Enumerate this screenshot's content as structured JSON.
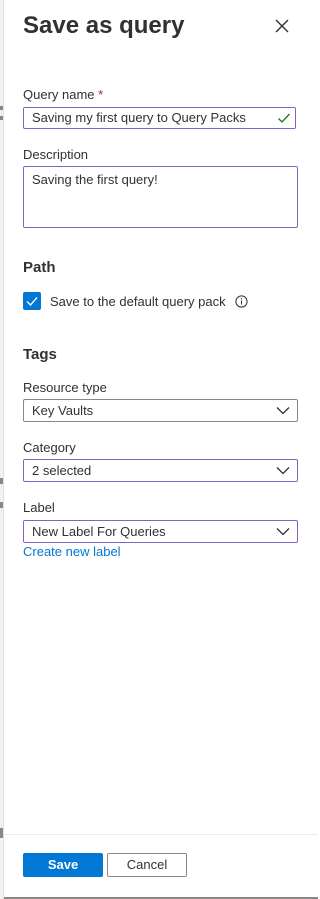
{
  "panel": {
    "title": "Save as query",
    "close_label": "Close"
  },
  "query_name": {
    "label": "Query name",
    "required_mark": "*",
    "value": "Saving my first query to Query Packs"
  },
  "description": {
    "label": "Description",
    "value": "Saving the first query!"
  },
  "path": {
    "heading": "Path",
    "checkbox_label": "Save to the default query pack",
    "checked": true
  },
  "tags": {
    "heading": "Tags",
    "resource_type": {
      "label": "Resource type",
      "value": "Key Vaults"
    },
    "category": {
      "label": "Category",
      "value": "2 selected"
    },
    "label_field": {
      "label": "Label",
      "value": "New Label For Queries"
    },
    "create_link": "Create new label"
  },
  "footer": {
    "save_label": "Save",
    "cancel_label": "Cancel"
  },
  "colors": {
    "accent": "#0078d4",
    "focus_border": "#8661c5",
    "valid_check": "#107c10"
  }
}
